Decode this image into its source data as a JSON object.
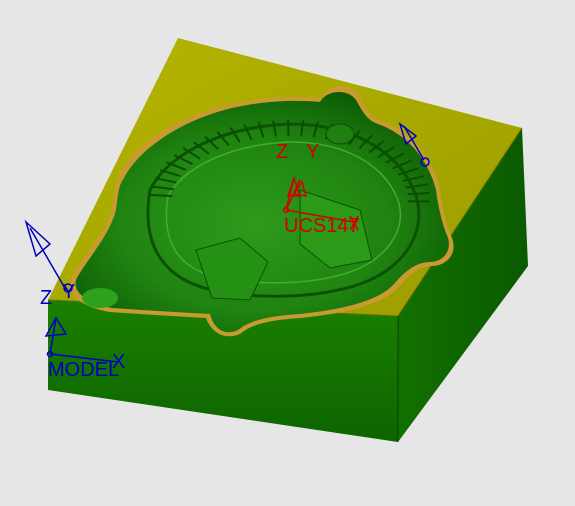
{
  "viewport": {
    "background": "#e6e6e6",
    "part": {
      "top_face_color": "#a8a800",
      "side_face_color": "#0f6a00",
      "cavity_color": "#1f8a10",
      "cavity_rim_color": "#c89a30"
    }
  },
  "ucs": {
    "name": "UCS147",
    "axis_z": "Z",
    "axis_y": "Y",
    "axis_x": "X",
    "color": "#d40000"
  },
  "model_csys": {
    "name": "MODEL",
    "axis_z": "Z",
    "axis_y": "Y",
    "axis_x": "X",
    "color": "#0000c0"
  },
  "icons": {
    "ucs_triad": "coordinate-triad-icon",
    "model_triad": "coordinate-triad-icon",
    "view_arrow": "view-direction-arrow-icon"
  }
}
